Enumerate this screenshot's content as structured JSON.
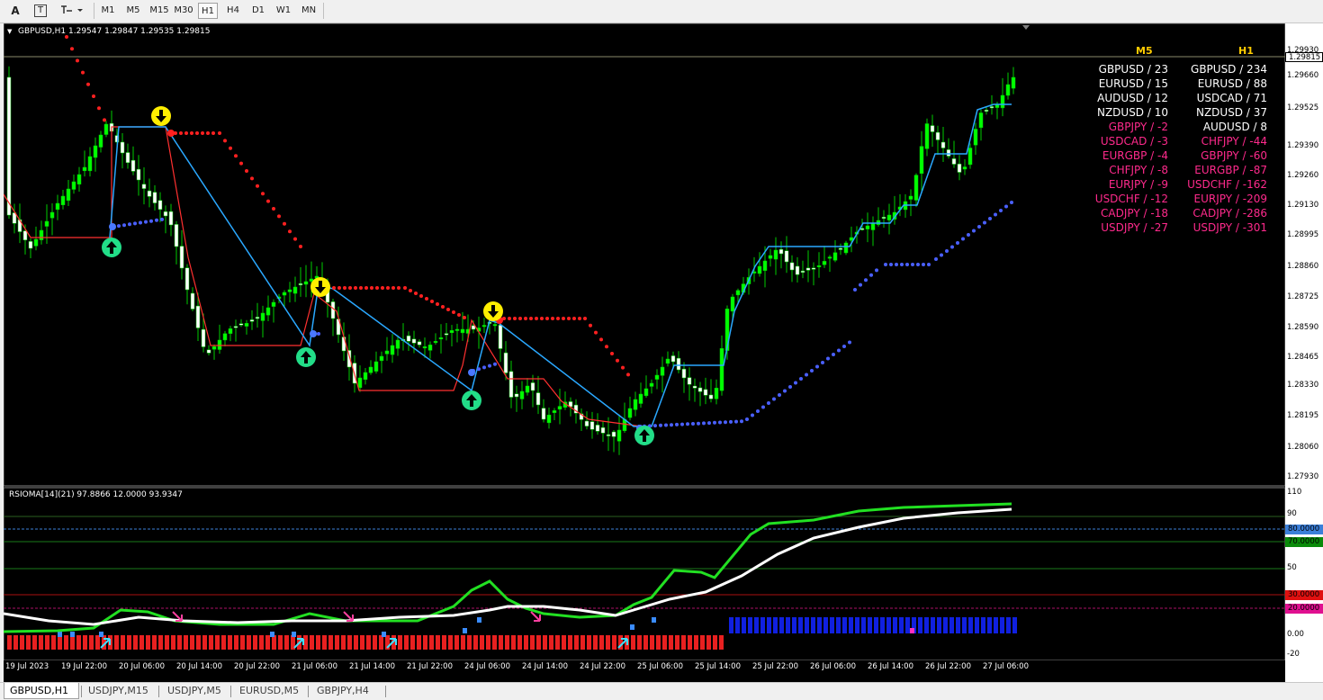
{
  "toolbar": {
    "text_tool": "A",
    "text_label_tool": "T",
    "timeframes": [
      "M1",
      "M5",
      "M15",
      "M30",
      "H1",
      "H4",
      "D1",
      "W1",
      "MN"
    ],
    "active_timeframe": "H1"
  },
  "main_chart": {
    "header": "GBPUSD,H1  1.29547 1.29847 1.29535 1.29815",
    "current_price": "1.29815",
    "price_axis": [
      "1.29930",
      "1.29660",
      "1.29525",
      "1.29390",
      "1.29260",
      "1.29130",
      "1.28995",
      "1.28860",
      "1.28725",
      "1.28590",
      "1.28465",
      "1.28330",
      "1.28195",
      "1.28060",
      "1.27930"
    ],
    "colors": {
      "bull": "#00ff00",
      "bear": "#ffffff",
      "bg": "#000000",
      "st_red": "#ff2020",
      "st_blue": "#4a78ff",
      "step_blue": "#2aa8ff"
    }
  },
  "strength_table": {
    "m5_header": "M5",
    "h1_header": "H1",
    "m5": [
      {
        "text": "GBPUSD / 23",
        "color": "#ffffff"
      },
      {
        "text": "EURUSD / 15",
        "color": "#ffffff"
      },
      {
        "text": "AUDUSD / 12",
        "color": "#ffffff"
      },
      {
        "text": "NZDUSD / 10",
        "color": "#ffffff"
      },
      {
        "text": "GBPJPY / -2",
        "color": "#ff2a8c"
      },
      {
        "text": "USDCAD / -3",
        "color": "#ff2a8c"
      },
      {
        "text": "EURGBP / -4",
        "color": "#ff2a8c"
      },
      {
        "text": "CHFJPY / -8",
        "color": "#ff2a8c"
      },
      {
        "text": "EURJPY / -9",
        "color": "#ff2a8c"
      },
      {
        "text": "USDCHF / -12",
        "color": "#ff2a8c"
      },
      {
        "text": "CADJPY / -18",
        "color": "#ff2a8c"
      },
      {
        "text": "USDJPY / -27",
        "color": "#ff2a8c"
      }
    ],
    "h1": [
      {
        "text": "GBPUSD / 234",
        "color": "#ffffff"
      },
      {
        "text": "EURUSD / 88",
        "color": "#ffffff"
      },
      {
        "text": "USDCAD / 71",
        "color": "#ffffff"
      },
      {
        "text": "NZDUSD / 37",
        "color": "#ffffff"
      },
      {
        "text": "AUDUSD / 8",
        "color": "#ffffff"
      },
      {
        "text": "CHFJPY / -44",
        "color": "#ff2a8c"
      },
      {
        "text": "GBPJPY / -60",
        "color": "#ff2a8c"
      },
      {
        "text": "EURGBP / -87",
        "color": "#ff2a8c"
      },
      {
        "text": "USDCHF / -162",
        "color": "#ff2a8c"
      },
      {
        "text": "EURJPY / -209",
        "color": "#ff2a8c"
      },
      {
        "text": "CADJPY / -286",
        "color": "#ff2a8c"
      },
      {
        "text": "USDJPY / -301",
        "color": "#ff2a8c"
      }
    ]
  },
  "indicator": {
    "header": "RSIOMA[14](21) 97.8866 12.0000 93.9347",
    "axis": [
      "110",
      "90",
      "80.0000",
      "70.0000",
      "50",
      "30.0000",
      "20.0000",
      "0.00",
      "-20"
    ],
    "level_80_bg": "#3b7fd9",
    "level_70_bg": "#0a8a0a",
    "level_30_bg": "#e01010",
    "level_20_bg": "#e01090"
  },
  "time_axis": [
    "19 Jul 2023",
    "19 Jul 22:00",
    "20 Jul 06:00",
    "20 Jul 14:00",
    "20 Jul 22:00",
    "21 Jul 06:00",
    "21 Jul 14:00",
    "21 Jul 22:00",
    "24 Jul 06:00",
    "24 Jul 14:00",
    "24 Jul 22:00",
    "25 Jul 06:00",
    "25 Jul 14:00",
    "25 Jul 22:00",
    "26 Jul 06:00",
    "26 Jul 14:00",
    "26 Jul 22:00",
    "27 Jul 06:00"
  ],
  "tabs": [
    "GBPUSD,H1",
    "USDJPY,M15",
    "USDJPY,M5",
    "EURUSD,M5",
    "GBPJPY,H4"
  ],
  "active_tab": "GBPUSD,H1"
}
